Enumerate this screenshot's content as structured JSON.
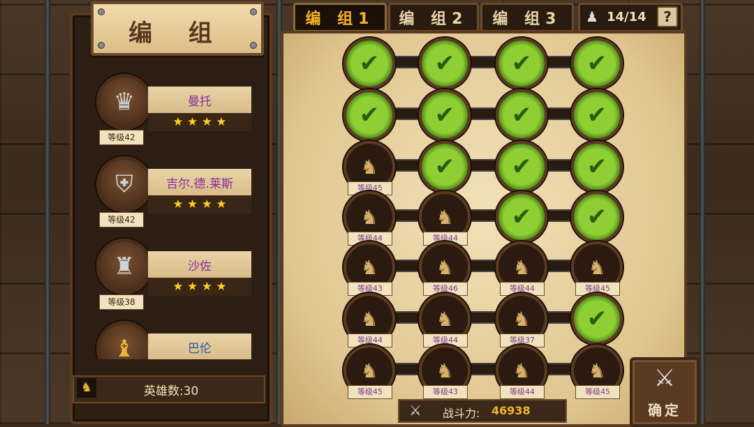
{
  "colors": {
    "accent": "#f5b52a",
    "name_purple": "#8a2a9a",
    "check_green": "#8fcf33"
  },
  "title": "编 组",
  "heroes": [
    {
      "name": "曼托",
      "level": "等级42",
      "stars": "★ ★ ★ ★",
      "icon": "knight-crown-icon"
    },
    {
      "name": "吉尔.德.莱斯",
      "level": "等级42",
      "stars": "★ ★ ★ ★",
      "icon": "knight-helmet-icon"
    },
    {
      "name": "沙佐",
      "level": "等级38",
      "stars": "★ ★ ★ ★",
      "icon": "dark-knight-icon"
    },
    {
      "name": "巴伦",
      "level": "",
      "stars": "",
      "icon": "golden-helmet-icon"
    }
  ],
  "hero_count": "英雄数:30",
  "tabs": [
    "编 组1",
    "编 组2",
    "编 组3"
  ],
  "active_tab": 0,
  "troops": "14/14",
  "help": "?",
  "grid": [
    [
      {
        "level": ""
      },
      {
        "level": ""
      },
      {
        "level": ""
      },
      {
        "level": ""
      }
    ],
    [
      {
        "level": ""
      },
      {
        "level": ""
      },
      {
        "level": ""
      },
      {
        "level": ""
      }
    ],
    [
      {
        "level": "等级45",
        "icon": "pirate-icon"
      },
      {
        "level": ""
      },
      {
        "level": ""
      },
      {
        "level": ""
      }
    ],
    [
      {
        "level": "等级44",
        "icon": "barbarian-icon"
      },
      {
        "level": "等级44",
        "icon": "purple-knight-icon"
      },
      {
        "level": ""
      },
      {
        "level": ""
      }
    ],
    [
      {
        "level": "等级43",
        "icon": "dwarf-icon"
      },
      {
        "level": "等级46",
        "icon": "dark-rider-icon"
      },
      {
        "level": "等级44",
        "icon": "black-knight-icon"
      },
      {
        "level": "等级45",
        "icon": "golden-rider-icon"
      }
    ],
    [
      {
        "level": "等级44",
        "icon": "witch-icon"
      },
      {
        "level": "等级44",
        "icon": "king-icon"
      },
      {
        "level": "等级37",
        "icon": "magician-icon"
      },
      {
        "level": ""
      }
    ],
    [
      {
        "level": "等级45",
        "icon": "valkyrie-icon"
      },
      {
        "level": "等级43",
        "icon": "gold-knight-icon"
      },
      {
        "level": "等级44",
        "icon": "paladin-icon"
      },
      {
        "level": "等级45",
        "icon": "berserker-icon"
      }
    ]
  ],
  "power": {
    "label": "战斗力:",
    "value": "46938"
  },
  "confirm": "确定"
}
